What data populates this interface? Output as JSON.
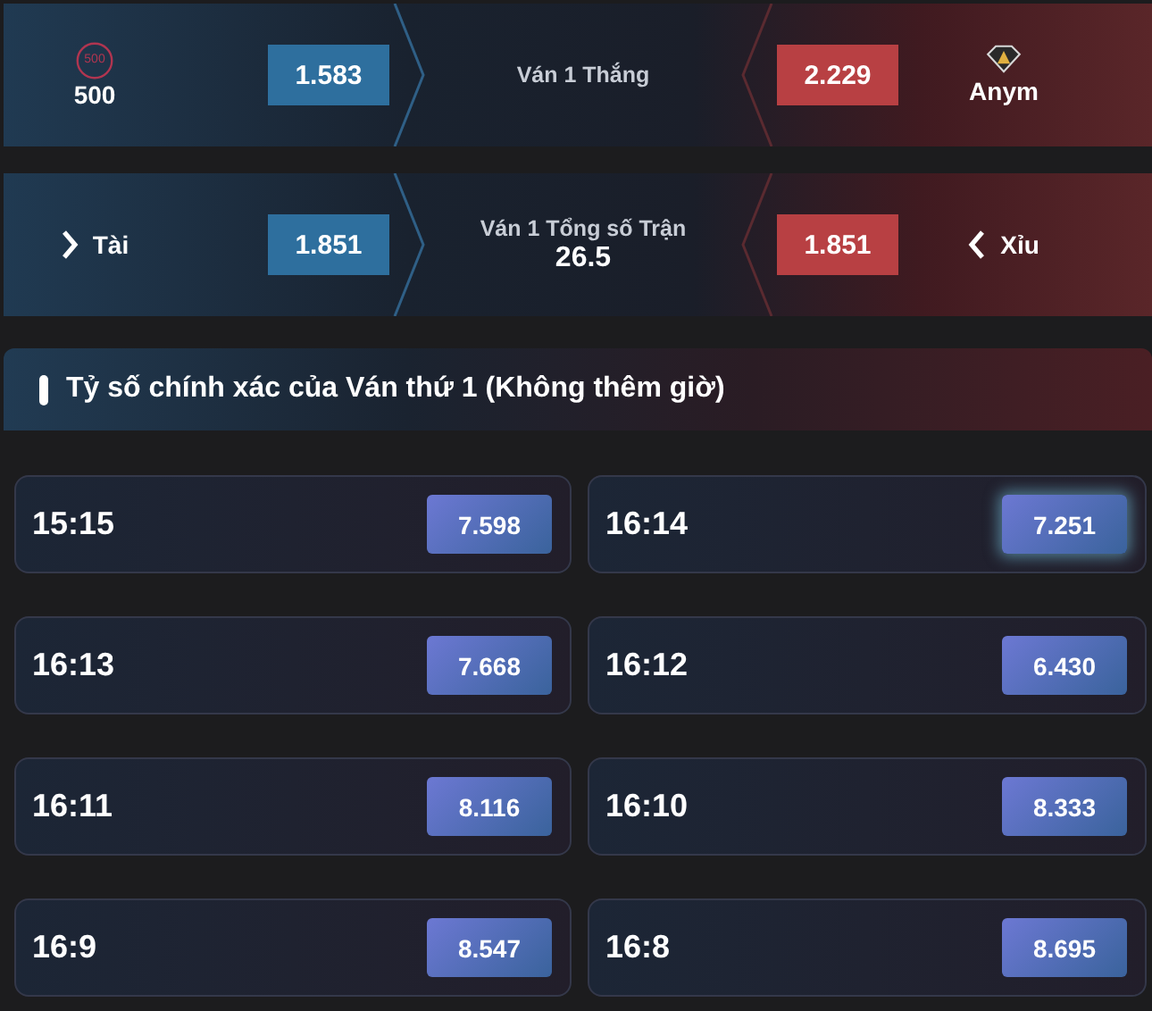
{
  "match_winner": {
    "title": "Ván 1 Thắng",
    "home": {
      "name": "500",
      "logo_text": "500",
      "odds": "1.583"
    },
    "away": {
      "name": "Anym",
      "odds": "2.229"
    }
  },
  "total": {
    "title": "Ván 1 Tổng số Trận",
    "line": "26.5",
    "over": {
      "label": "Tài",
      "odds": "1.851"
    },
    "under": {
      "label": "Xỉu",
      "odds": "1.851"
    }
  },
  "correct_score": {
    "title": "Tỷ số chính xác của Ván thứ 1 (Không thêm giờ)",
    "items": [
      {
        "score": "15:15",
        "odds": "7.598",
        "selected": false
      },
      {
        "score": "16:14",
        "odds": "7.251",
        "selected": true
      },
      {
        "score": "16:13",
        "odds": "7.668",
        "selected": false
      },
      {
        "score": "16:12",
        "odds": "6.430",
        "selected": false
      },
      {
        "score": "16:11",
        "odds": "8.116",
        "selected": false
      },
      {
        "score": "16:10",
        "odds": "8.333",
        "selected": false
      },
      {
        "score": "16:9",
        "odds": "8.547",
        "selected": false
      },
      {
        "score": "16:8",
        "odds": "8.695",
        "selected": false
      }
    ]
  }
}
